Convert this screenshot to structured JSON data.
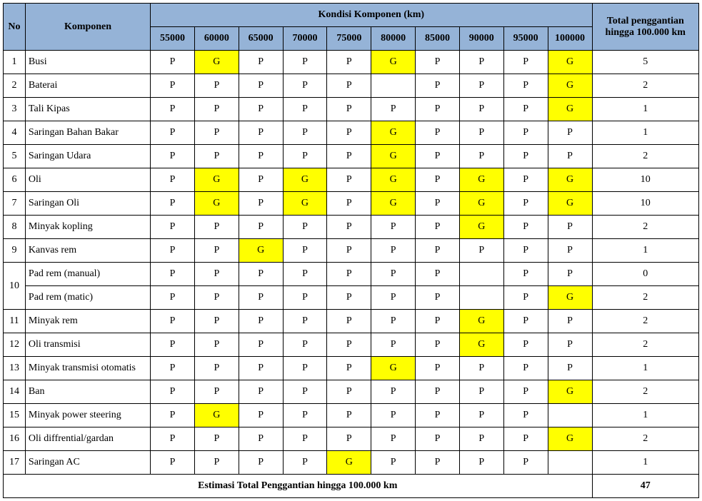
{
  "headers": {
    "no": "No",
    "komponen": "Komponen",
    "kondisi": "Kondisi Komponen (km)",
    "total": "Total penggantian hingga 100.000 km",
    "km": [
      "55000",
      "60000",
      "65000",
      "70000",
      "75000",
      "80000",
      "85000",
      "90000",
      "95000",
      "100000"
    ]
  },
  "rows": [
    {
      "no": "1",
      "name": "Busi",
      "cells": [
        "P",
        "G",
        "P",
        "P",
        "P",
        "G",
        "P",
        "P",
        "P",
        "G"
      ],
      "total": "5"
    },
    {
      "no": "2",
      "name": "Baterai",
      "cells": [
        "P",
        "P",
        "P",
        "P",
        "P",
        "",
        "P",
        "P",
        "P",
        "G"
      ],
      "total": "2"
    },
    {
      "no": "3",
      "name": "Tali Kipas",
      "cells": [
        "P",
        "P",
        "P",
        "P",
        "P",
        "P",
        "P",
        "P",
        "P",
        "G"
      ],
      "total": "1"
    },
    {
      "no": "4",
      "name": "Saringan Bahan Bakar",
      "cells": [
        "P",
        "P",
        "P",
        "P",
        "P",
        "G",
        "P",
        "P",
        "P",
        "P"
      ],
      "total": "1"
    },
    {
      "no": "5",
      "name": "Saringan Udara",
      "cells": [
        "P",
        "P",
        "P",
        "P",
        "P",
        "G",
        "P",
        "P",
        "P",
        "P"
      ],
      "total": "2"
    },
    {
      "no": "6",
      "name": "Oli",
      "cells": [
        "P",
        "G",
        "P",
        "G",
        "P",
        "G",
        "P",
        "G",
        "P",
        "G"
      ],
      "total": "10"
    },
    {
      "no": "7",
      "name": "Saringan Oli",
      "cells": [
        "P",
        "G",
        "P",
        "G",
        "P",
        "G",
        "P",
        "G",
        "P",
        "G"
      ],
      "total": "10"
    },
    {
      "no": "8",
      "name": "Minyak kopling",
      "cells": [
        "P",
        "P",
        "P",
        "P",
        "P",
        "P",
        "P",
        "G",
        "P",
        "P"
      ],
      "total": "2"
    },
    {
      "no": "9",
      "name": "Kanvas rem",
      "cells": [
        "P",
        "P",
        "G",
        "P",
        "P",
        "P",
        "P",
        "P",
        "P",
        "P"
      ],
      "total": "1"
    },
    {
      "no": "10",
      "name": "Pad rem (manual)",
      "cells": [
        "P",
        "P",
        "P",
        "P",
        "P",
        "P",
        "P",
        "",
        "P",
        "P"
      ],
      "total": "0",
      "rowspan": 2
    },
    {
      "no": "",
      "name": "Pad rem (matic)",
      "cells": [
        "P",
        "P",
        "P",
        "P",
        "P",
        "P",
        "P",
        "",
        "P",
        "G"
      ],
      "total": "2",
      "skipNo": true
    },
    {
      "no": "11",
      "name": "Minyak rem",
      "cells": [
        "P",
        "P",
        "P",
        "P",
        "P",
        "P",
        "P",
        "G",
        "P",
        "P"
      ],
      "total": "2"
    },
    {
      "no": "12",
      "name": "Oli transmisi",
      "cells": [
        "P",
        "P",
        "P",
        "P",
        "P",
        "P",
        "P",
        "G",
        "P",
        "P"
      ],
      "total": "2"
    },
    {
      "no": "13",
      "name": "Minyak transmisi otomatis",
      "cells": [
        "P",
        "P",
        "P",
        "P",
        "P",
        "G",
        "P",
        "P",
        "P",
        "P"
      ],
      "total": "1"
    },
    {
      "no": "14",
      "name": "Ban",
      "cells": [
        "P",
        "P",
        "P",
        "P",
        "P",
        "P",
        "P",
        "P",
        "P",
        "G"
      ],
      "total": "2"
    },
    {
      "no": "15",
      "name": "Minyak power steering",
      "cells": [
        "P",
        "G",
        "P",
        "P",
        "P",
        "P",
        "P",
        "P",
        "P",
        ""
      ],
      "total": "1"
    },
    {
      "no": "16",
      "name": "Oli diffrential/gardan",
      "cells": [
        "P",
        "P",
        "P",
        "P",
        "P",
        "P",
        "P",
        "P",
        "P",
        "G"
      ],
      "total": "2"
    },
    {
      "no": "17",
      "name": "Saringan AC",
      "cells": [
        "P",
        "P",
        "P",
        "P",
        "G",
        "P",
        "P",
        "P",
        "P",
        ""
      ],
      "total": "1"
    }
  ],
  "footer": {
    "label": "Estimasi Total Penggantian hingga 100.000 km",
    "total": "47"
  }
}
